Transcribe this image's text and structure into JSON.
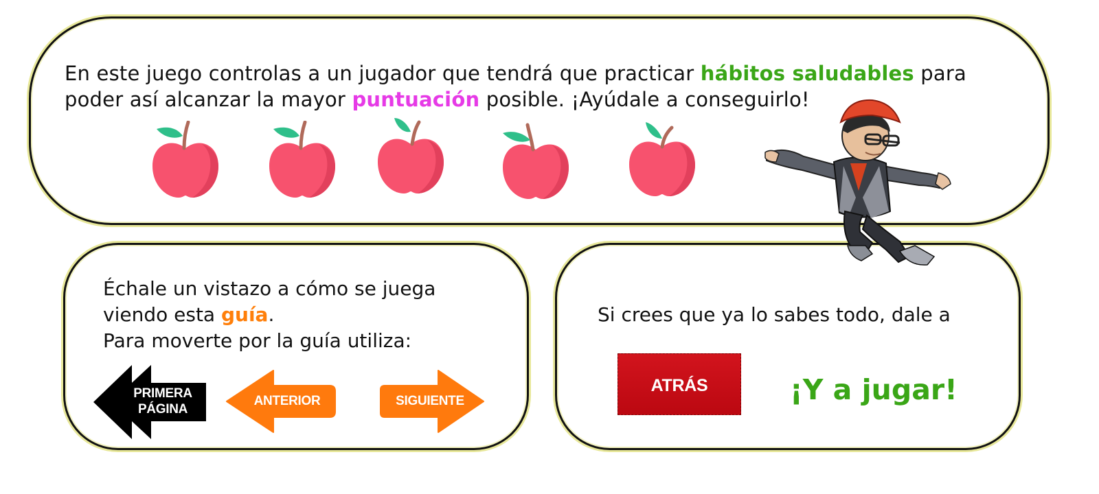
{
  "intro": {
    "line1_before": "En este juego controlas a un jugador que tendrá que practicar ",
    "line1_highlight": "hábitos saludables",
    "line1_after": " para",
    "line2_before": "poder así alcanzar la mayor ",
    "line2_highlight": "puntuación",
    "line2_after": " posible. ¡Ayúdale a conseguirlo!",
    "apple_count": 5
  },
  "guide": {
    "line1": "Échale un vistazo a cómo se juega",
    "line2_before": "viendo esta ",
    "line2_highlight": "guía",
    "line2_after": ".",
    "line3": "Para moverte por la guía utiliza:",
    "first_page_line1": "PRIMERA",
    "first_page_line2": "PÁGINA",
    "previous_label": "ANTERIOR",
    "next_label": "SIGUIENTE"
  },
  "play": {
    "text": "Si crees que ya lo sabes todo, dale a",
    "back_label": "ATRÁS",
    "play_label": "¡Y a jugar!"
  },
  "colors": {
    "highlight_green": "#3aa617",
    "highlight_pink": "#e63ae6",
    "highlight_orange": "#ff7f0a",
    "nav_orange": "#ff7a0d",
    "nav_black": "#000000",
    "back_red": "#c80f17",
    "apple_red": "#f7526e"
  }
}
